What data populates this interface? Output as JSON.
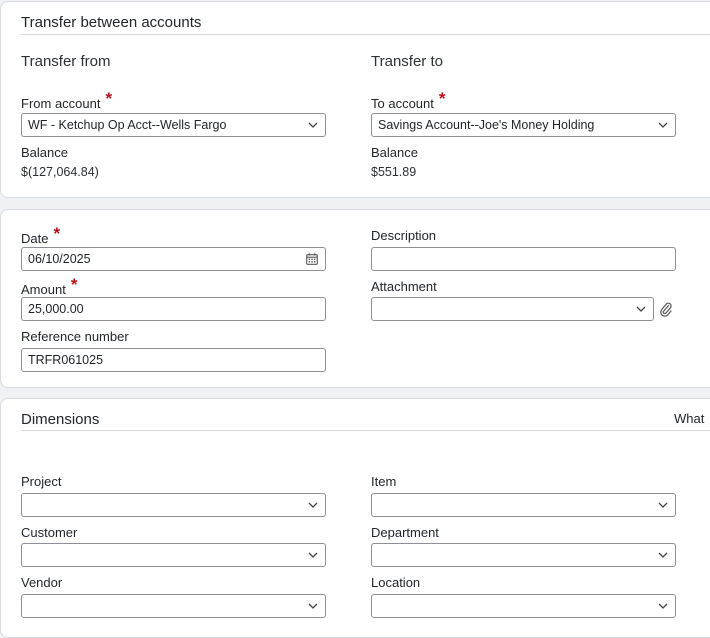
{
  "transfer": {
    "title": "Transfer between accounts",
    "from_heading": "Transfer from",
    "to_heading": "Transfer to",
    "from_account_label": "From account",
    "from_account_value": "WF - Ketchup Op Acct--Wells Fargo",
    "to_account_label": "To account",
    "to_account_value": "Savings Account--Joe's Money Holding",
    "from_balance_label": "Balance",
    "from_balance_value": "$(127,064.84)",
    "to_balance_label": "Balance",
    "to_balance_value": "$551.89",
    "required_mark": "*"
  },
  "details": {
    "date_label": "Date",
    "date_value": "06/10/2025",
    "description_label": "Description",
    "description_value": "",
    "amount_label": "Amount",
    "amount_value": "25,000.00",
    "attachment_label": "Attachment",
    "attachment_value": "",
    "reference_label": "Reference number",
    "reference_value": "TRFR061025"
  },
  "dimensions": {
    "title": "Dimensions",
    "what_link": "What",
    "project_label": "Project",
    "project_value": "",
    "item_label": "Item",
    "item_value": "",
    "customer_label": "Customer",
    "customer_value": "",
    "department_label": "Department",
    "department_value": "",
    "vendor_label": "Vendor",
    "vendor_value": "",
    "location_label": "Location",
    "location_value": ""
  },
  "icons": {
    "dropdown": "chevron-down-icon",
    "calendar": "calendar-icon",
    "attachment": "paperclip-icon"
  },
  "colors": {
    "required": "#b3121d",
    "field_border": "#8d9096",
    "card_border": "#d7dae0",
    "page_background": "#f0f1f4"
  }
}
